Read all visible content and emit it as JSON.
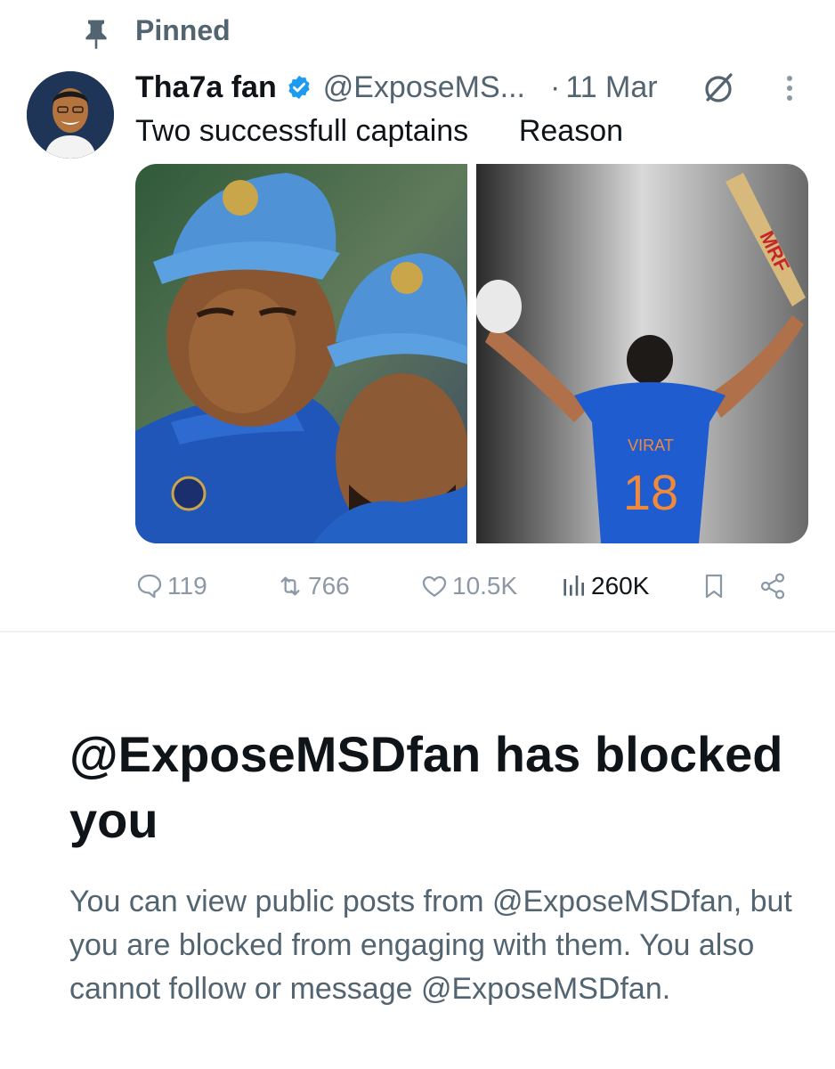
{
  "pinned": {
    "label": "Pinned",
    "icon": "pin-icon"
  },
  "tweet": {
    "author": {
      "display_name": "Tha7a fan",
      "handle": "@ExposeMS...",
      "verified_icon": "verified-badge-icon",
      "avatar": "avatar"
    },
    "separator": "·",
    "date": "11 Mar",
    "text": "Two successfull captains      Reason",
    "media": [
      {
        "name": "media-image-captains"
      },
      {
        "name": "media-image-virat",
        "jersey_name": "VIRAT",
        "jersey_number": "18",
        "bat_text": "MRF"
      }
    ],
    "actions": {
      "replies": "119",
      "reposts": "766",
      "likes": "10.5K",
      "views": "260K"
    }
  },
  "blocked": {
    "title": "@ExposeMSDfan has blocked you",
    "description": "You can view public posts from @ExposeMSDfan, but you are blocked from engaging with them. You also cannot follow or message @ExposeMSDfan."
  },
  "colors": {
    "text_primary": "#0f1419",
    "text_secondary": "#536471",
    "verified": "#1d9bf0",
    "action_gray": "#8b98a5",
    "divider": "#eff3f4"
  }
}
